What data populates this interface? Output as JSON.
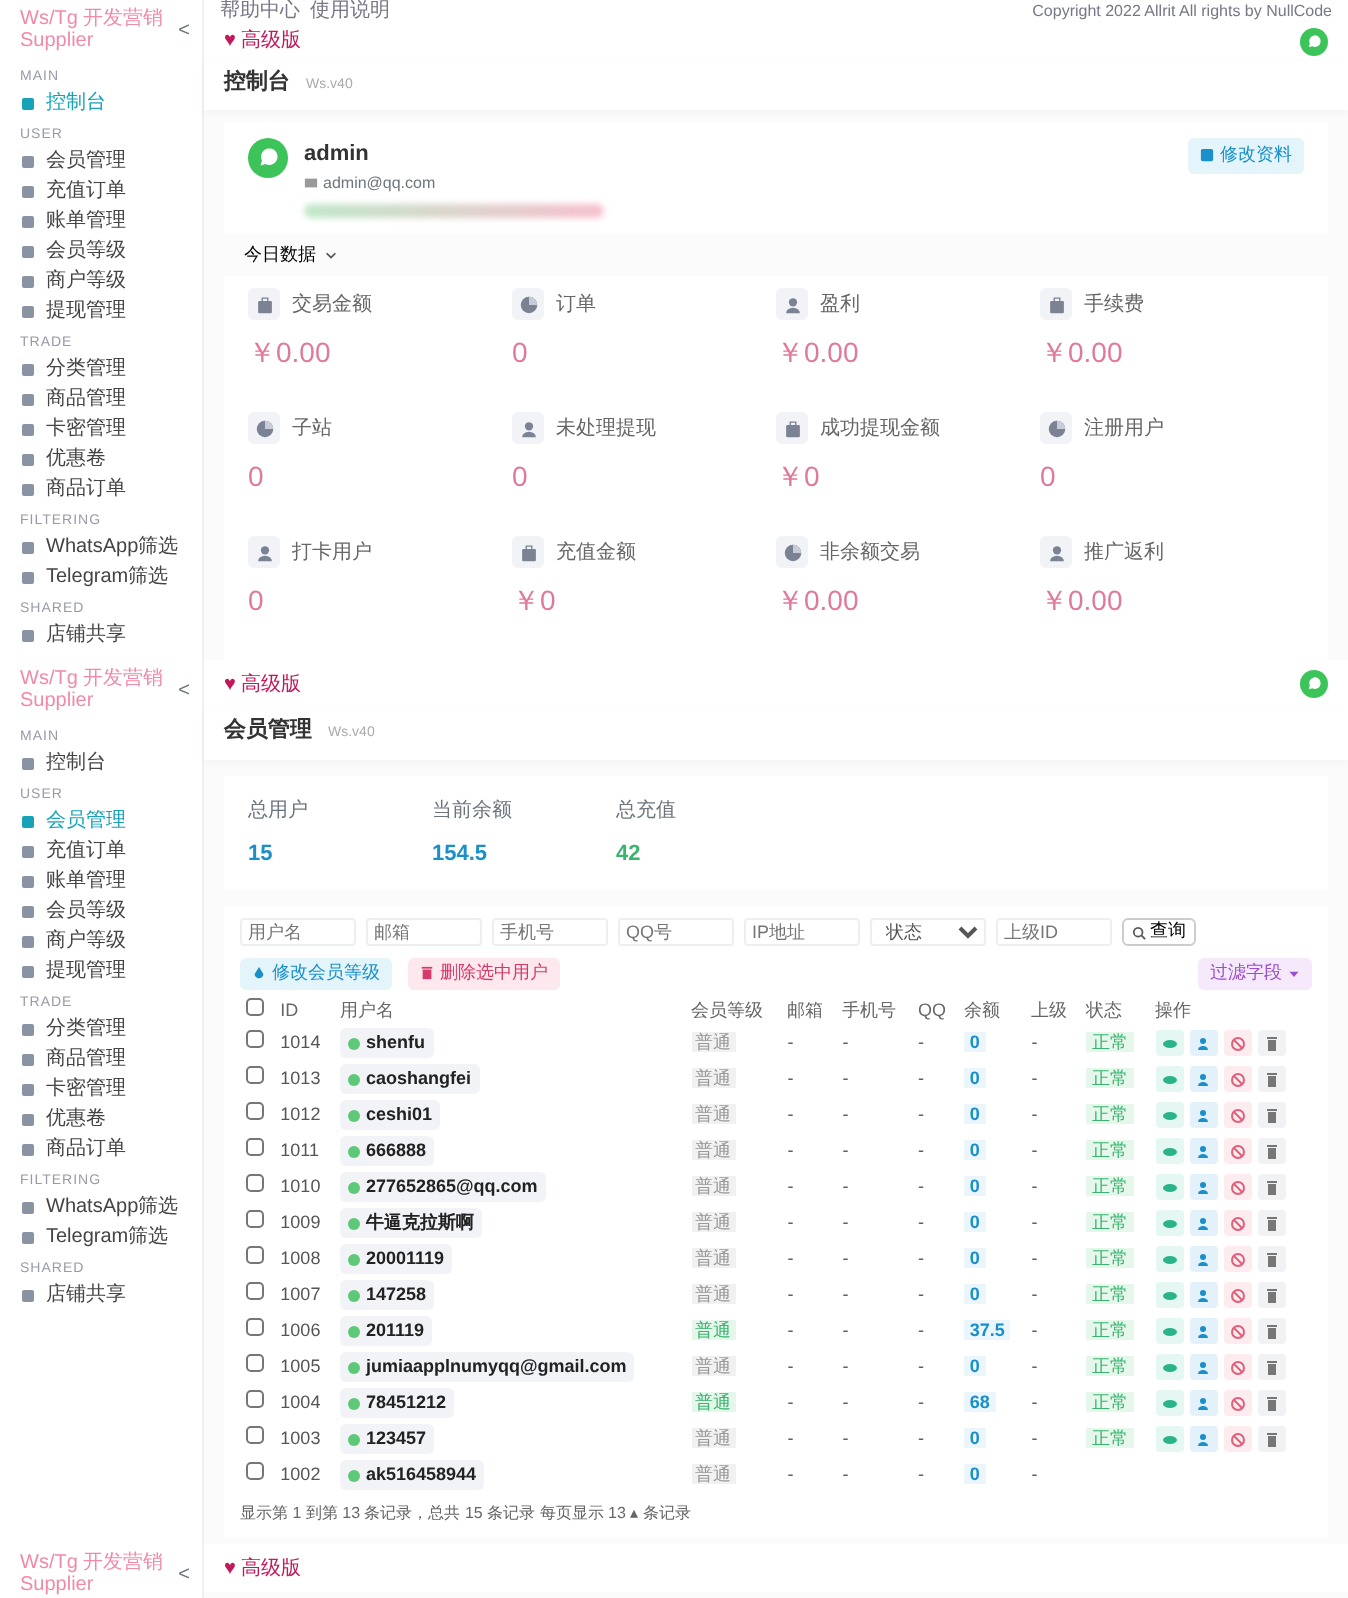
{
  "screens": [
    {
      "top_strip": {
        "links": [
          "帮助中心",
          "使用说明"
        ],
        "copyright": "Copyright 2022 Allrit All rights by NullCode"
      },
      "sidebar": {
        "brand": "Ws/Tg 开发营销 Supplier",
        "collapse": "<",
        "sections": [
          {
            "title": "MAIN",
            "items": [
              {
                "label": "控制台",
                "selected": true
              }
            ]
          },
          {
            "title": "USER",
            "items": [
              {
                "label": "会员管理",
                "selected": false
              },
              {
                "label": "充值订单",
                "selected": false
              },
              {
                "label": "账单管理",
                "selected": false
              },
              {
                "label": "会员等级",
                "selected": false
              },
              {
                "label": "商户等级",
                "selected": false
              },
              {
                "label": "提现管理",
                "selected": false
              }
            ]
          },
          {
            "title": "TRADE",
            "items": [
              {
                "label": "分类管理",
                "selected": false
              },
              {
                "label": "商品管理",
                "selected": false
              },
              {
                "label": "卡密管理",
                "selected": false
              },
              {
                "label": "优惠卷",
                "selected": false
              },
              {
                "label": "商品订单",
                "selected": false
              }
            ]
          },
          {
            "title": "FILTERING",
            "items": [
              {
                "label": "WhatsApp筛选",
                "selected": false
              },
              {
                "label": "Telegram筛选",
                "selected": false
              }
            ]
          },
          {
            "title": "SHARED",
            "items": [
              {
                "label": "店铺共享",
                "selected": false
              }
            ]
          }
        ]
      },
      "header": {
        "badge": "♥ 高级版"
      },
      "page_title": "控制台",
      "version": "Ws.v40",
      "profile": {
        "name": "admin",
        "email": "admin@qq.com",
        "button": "修改资料"
      },
      "range": "今日数据",
      "stats": [
        {
          "label": "交易金额",
          "value": "￥0.00"
        },
        {
          "label": "订单",
          "value": "0"
        },
        {
          "label": "盈利",
          "value": "￥0.00"
        },
        {
          "label": "手续费",
          "value": "￥0.00"
        },
        {
          "label": "子站",
          "value": "0"
        },
        {
          "label": "未处理提现",
          "value": "0"
        },
        {
          "label": "成功提现金额",
          "value": "￥0"
        },
        {
          "label": "注册用户",
          "value": "0"
        },
        {
          "label": "打卡用户",
          "value": "0"
        },
        {
          "label": "充值金额",
          "value": "￥0"
        },
        {
          "label": "非余额交易",
          "value": "￥0.00"
        },
        {
          "label": "推广返利",
          "value": "￥0.00"
        }
      ]
    },
    {
      "sidebar": {
        "brand": "Ws/Tg 开发营销 Supplier",
        "collapse": "<",
        "sections": [
          {
            "title": "MAIN",
            "items": [
              {
                "label": "控制台",
                "selected": false
              }
            ]
          },
          {
            "title": "USER",
            "items": [
              {
                "label": "会员管理",
                "selected": true
              },
              {
                "label": "充值订单",
                "selected": false
              },
              {
                "label": "账单管理",
                "selected": false
              },
              {
                "label": "会员等级",
                "selected": false
              },
              {
                "label": "商户等级",
                "selected": false
              },
              {
                "label": "提现管理",
                "selected": false
              }
            ]
          },
          {
            "title": "TRADE",
            "items": [
              {
                "label": "分类管理",
                "selected": false
              },
              {
                "label": "商品管理",
                "selected": false
              },
              {
                "label": "卡密管理",
                "selected": false
              },
              {
                "label": "优惠卷",
                "selected": false
              },
              {
                "label": "商品订单",
                "selected": false
              }
            ]
          },
          {
            "title": "FILTERING",
            "items": [
              {
                "label": "WhatsApp筛选",
                "selected": false
              },
              {
                "label": "Telegram筛选",
                "selected": false
              }
            ]
          },
          {
            "title": "SHARED",
            "items": [
              {
                "label": "店铺共享",
                "selected": false
              }
            ]
          }
        ]
      },
      "header": {
        "badge": "♥ 高级版"
      },
      "page_title": "会员管理",
      "version": "Ws.v40",
      "totals": [
        {
          "label": "总用户",
          "value": "15",
          "color": "#1a8fc9"
        },
        {
          "label": "当前余额",
          "value": "154.5",
          "color": "#1a8fc9"
        },
        {
          "label": "总充值",
          "value": "42",
          "color": "#3cb371"
        }
      ],
      "filters": [
        {
          "placeholder": "用户名",
          "kind": "input"
        },
        {
          "placeholder": "邮箱",
          "kind": "input"
        },
        {
          "placeholder": "手机号",
          "kind": "input"
        },
        {
          "placeholder": "QQ号",
          "kind": "input"
        },
        {
          "placeholder": "IP地址",
          "kind": "input"
        },
        {
          "placeholder": "状态",
          "kind": "select"
        },
        {
          "placeholder": "上级ID",
          "kind": "input"
        }
      ],
      "search_button": "查询",
      "actions": [
        {
          "label": "修改会员等级",
          "kind": "primary"
        },
        {
          "label": "删除选中用户",
          "kind": "danger"
        }
      ],
      "column_filter": "过滤字段",
      "table": {
        "columns": [
          "ID",
          "用户名",
          "会员等级",
          "邮箱",
          "手机号",
          "QQ",
          "余额",
          "上级",
          "状态",
          "操作"
        ],
        "header_checked": false,
        "rows": [
          {
            "checked": false,
            "id": "1014",
            "username": "shenfu",
            "level": "普通",
            "level_highlight": false,
            "email": "-",
            "phone": "-",
            "qq": "-",
            "balance": "0",
            "parent": "-",
            "status": "正常",
            "actions": true
          },
          {
            "checked": false,
            "id": "1013",
            "username": "caoshangfei",
            "level": "普通",
            "level_highlight": false,
            "email": "-",
            "phone": "-",
            "qq": "-",
            "balance": "0",
            "parent": "-",
            "status": "正常",
            "actions": true
          },
          {
            "checked": false,
            "id": "1012",
            "username": "ceshi01",
            "level": "普通",
            "level_highlight": false,
            "email": "-",
            "phone": "-",
            "qq": "-",
            "balance": "0",
            "parent": "-",
            "status": "正常",
            "actions": true
          },
          {
            "checked": false,
            "id": "1011",
            "username": "666888",
            "level": "普通",
            "level_highlight": false,
            "email": "-",
            "phone": "-",
            "qq": "-",
            "balance": "0",
            "parent": "-",
            "status": "正常",
            "actions": true
          },
          {
            "checked": false,
            "id": "1010",
            "username": "277652865@qq.com",
            "level": "普通",
            "level_highlight": false,
            "email": "-",
            "phone": "-",
            "qq": "-",
            "balance": "0",
            "parent": "-",
            "status": "正常",
            "actions": true
          },
          {
            "checked": false,
            "id": "1009",
            "username": "牛逼克拉斯啊",
            "level": "普通",
            "level_highlight": false,
            "email": "-",
            "phone": "-",
            "qq": "-",
            "balance": "0",
            "parent": "-",
            "status": "正常",
            "actions": true
          },
          {
            "checked": false,
            "id": "1008",
            "username": "20001119",
            "level": "普通",
            "level_highlight": false,
            "email": "-",
            "phone": "-",
            "qq": "-",
            "balance": "0",
            "parent": "-",
            "status": "正常",
            "actions": true
          },
          {
            "checked": false,
            "id": "1007",
            "username": "147258",
            "level": "普通",
            "level_highlight": false,
            "email": "-",
            "phone": "-",
            "qq": "-",
            "balance": "0",
            "parent": "-",
            "status": "正常",
            "actions": true
          },
          {
            "checked": false,
            "id": "1006",
            "username": "201119",
            "level": "普通",
            "level_highlight": true,
            "email": "-",
            "phone": "-",
            "qq": "-",
            "balance": "37.5",
            "parent": "-",
            "status": "正常",
            "actions": true
          },
          {
            "checked": false,
            "id": "1005",
            "username": "jumiaapplnumyqq@gmail.com",
            "level": "普通",
            "level_highlight": false,
            "email": "-",
            "phone": "-",
            "qq": "-",
            "balance": "0",
            "parent": "-",
            "status": "正常",
            "actions": true
          },
          {
            "checked": false,
            "id": "1004",
            "username": "78451212",
            "level": "普通",
            "level_highlight": true,
            "email": "-",
            "phone": "-",
            "qq": "-",
            "balance": "68",
            "parent": "-",
            "status": "正常",
            "actions": true
          },
          {
            "checked": false,
            "id": "1003",
            "username": "123457",
            "level": "普通",
            "level_highlight": false,
            "email": "-",
            "phone": "-",
            "qq": "-",
            "balance": "0",
            "parent": "-",
            "status": "正常",
            "actions": true
          },
          {
            "checked": false,
            "id": "1002",
            "username": "ak516458944",
            "level": "普通",
            "level_highlight": false,
            "email": "-",
            "phone": "-",
            "qq": "-",
            "balance": "0",
            "parent": "-",
            "actions": false
          }
        ]
      },
      "pagination": "显示第 1 到第 13 条记录，总共 15 条记录 每页显示 13 ▴ 条记录"
    },
    {
      "sidebar": {
        "brand": "Ws/Tg 开发营销 Supplier",
        "collapse": "<"
      },
      "header": {
        "badge": "♥ 高级版"
      }
    }
  ]
}
